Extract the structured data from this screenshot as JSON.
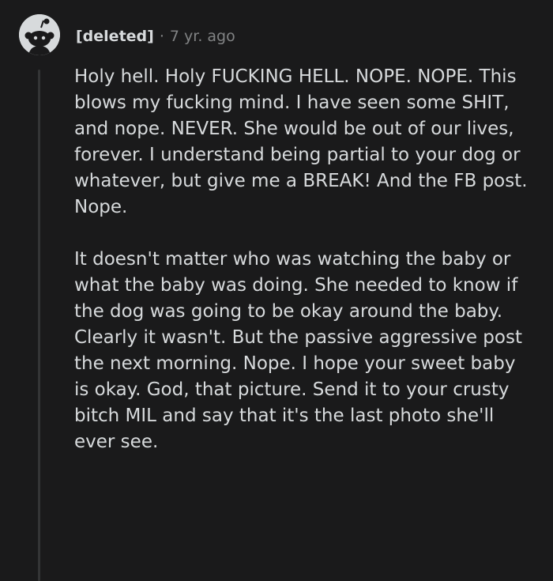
{
  "comment": {
    "author": "[deleted]",
    "separator": "·",
    "timestamp": "7 yr. ago",
    "avatar_icon": "deleted-user-avatar-icon",
    "paragraphs": [
      "Holy hell. Holy FUCKING HELL. NOPE. NOPE. This blows my fucking mind. I have seen some SHIT, and nope. NEVER. She would be out of our lives, forever. I understand being partial to your dog or whatever, but give me a BREAK! And the FB post. Nope.",
      "It doesn't matter who was watching the baby or what the baby was doing. She needed to know if the dog was going to be okay around the baby. Clearly it wasn't. But the passive aggressive post the next morning. Nope. I hope your sweet baby is okay. God, that picture. Send it to your crusty bitch MIL and say that it's the last photo she'll ever see."
    ]
  },
  "colors": {
    "background": "#1a1a1b",
    "text": "#d7dadc",
    "muted": "#818384",
    "thread_line": "#343536"
  }
}
